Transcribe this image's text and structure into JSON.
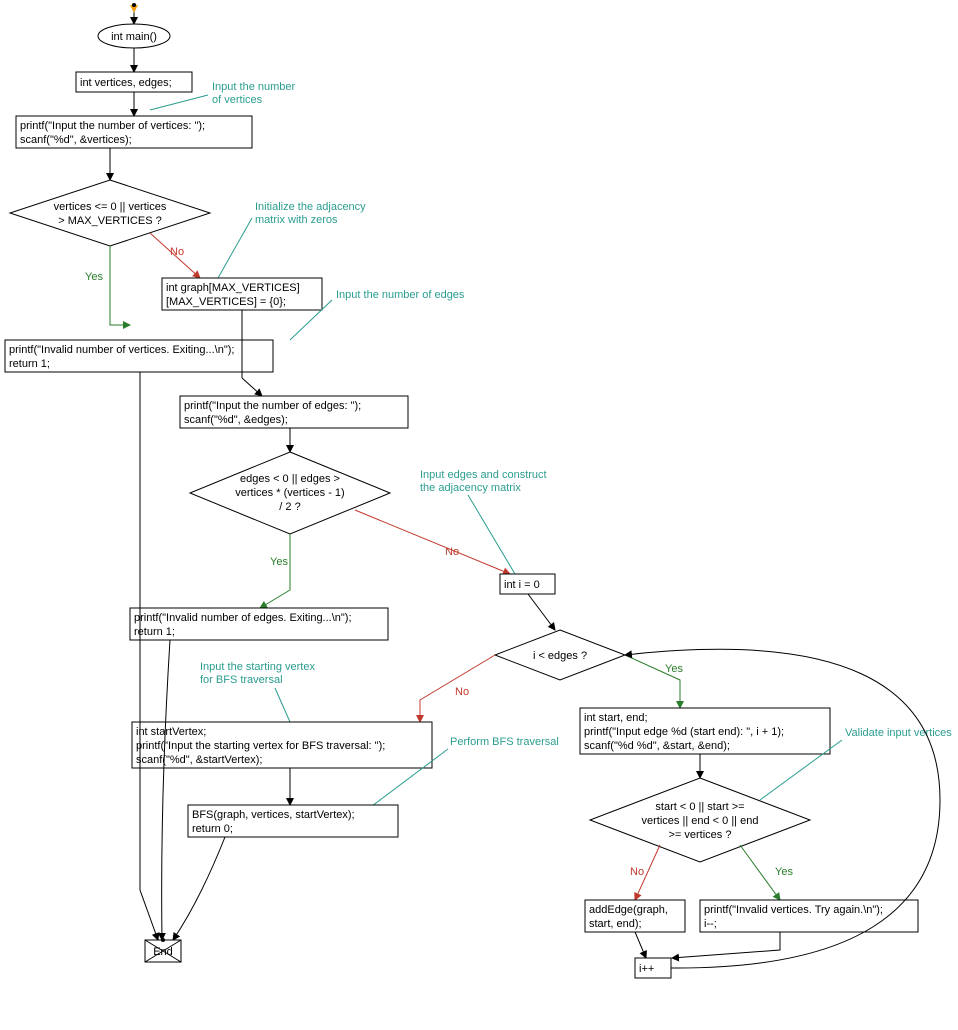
{
  "chart_data": {
    "type": "flowchart",
    "nodes": {
      "start": {
        "label": "int main()"
      },
      "decl": {
        "text": "int vertices, edges;"
      },
      "comment1": {
        "text1": "Input the number",
        "text2": "of vertices"
      },
      "input_vertices": {
        "line1": "printf(\"Input the number of vertices: \");",
        "line2": "scanf(\"%d\", &vertices);"
      },
      "cond_vertices": {
        "line1": "vertices <= 0 || vertices",
        "line2": "> MAX_VERTICES ?"
      },
      "comment2": {
        "text1": "Initialize the adjacency",
        "text2": "matrix with zeros"
      },
      "invalid_vertices": {
        "line1": "printf(\"Invalid number of vertices. Exiting...\\n\");",
        "line2": "return 1;"
      },
      "init_graph": {
        "line1": "int graph[MAX_VERTICES]",
        "line2": "[MAX_VERTICES] = {0};"
      },
      "comment3": {
        "text": "Input the number of edges"
      },
      "input_edges": {
        "line1": "printf(\"Input the number of edges: \");",
        "line2": "scanf(\"%d\", &edges);"
      },
      "cond_edges": {
        "line1": "edges < 0 || edges >",
        "line2": "vertices * (vertices - 1)",
        "line3": "/ 2 ?"
      },
      "comment4": {
        "text1": "Input edges and construct",
        "text2": "the adjacency matrix"
      },
      "invalid_edges": {
        "line1": "printf(\"Invalid number of edges. Exiting...\\n\");",
        "line2": "return 1;"
      },
      "init_i": {
        "text": "int i = 0"
      },
      "cond_loop": {
        "text": "i < edges ?"
      },
      "comment5": {
        "text1": "Input the starting vertex",
        "text2": "for BFS traversal"
      },
      "input_edge": {
        "line1": "int start, end;",
        "line2": "printf(\"Input edge %d (start end): \", i + 1);",
        "line3": "scanf(\"%d %d\", &start, &end);"
      },
      "comment6": {
        "text": "Validate input vertices"
      },
      "cond_startend": {
        "line1": "start < 0 || start >=",
        "line2": "vertices || end < 0 || end",
        "line3": ">= vertices ?"
      },
      "add_edge": {
        "line1": "addEdge(graph,",
        "line2": "start, end);"
      },
      "invalid_se": {
        "line1": "printf(\"Invalid vertices. Try again.\\n\");",
        "line2": "i--;"
      },
      "incr": {
        "text": "i++"
      },
      "input_start": {
        "line1": "int startVertex;",
        "line2": "printf(\"Input the starting vertex for BFS traversal: \");",
        "line3": "scanf(\"%d\", &startVertex);"
      },
      "comment7": {
        "text": "Perform BFS traversal"
      },
      "bfs": {
        "line1": "BFS(graph, vertices, startVertex);",
        "line2": "return 0;"
      },
      "end": {
        "text": "End"
      }
    },
    "labels": {
      "yes": "Yes",
      "no": "No"
    }
  }
}
